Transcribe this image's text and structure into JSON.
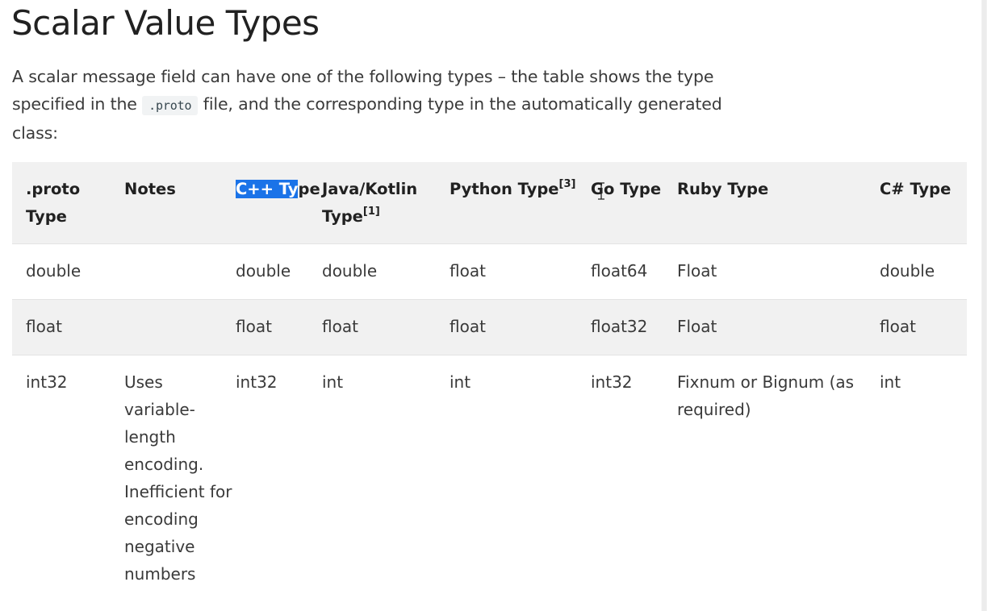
{
  "page": {
    "heading": "Scalar Value Types",
    "intro_before_code": "A scalar message field can have one of the following types – the table shows the type specified in the ",
    "intro_code": ".proto",
    "intro_after_code": " file, and the corresponding type in the automatically generated class:"
  },
  "table": {
    "headers": {
      "proto": ".proto Type",
      "notes": "Notes",
      "cpp_selected": "C++ Ty",
      "cpp_rest": "pe",
      "java": "Java/Kotlin Type",
      "java_sup": "[1]",
      "python": "Python Type",
      "python_sup": "[3]",
      "go": "Go Type",
      "ruby": "Ruby Type",
      "csharp": "C# Type"
    },
    "rows": [
      {
        "proto": "double",
        "notes": "",
        "cpp": "double",
        "java": "double",
        "python": "float",
        "go": "float64",
        "ruby": "Float",
        "csharp": "double"
      },
      {
        "proto": "float",
        "notes": "",
        "cpp": "float",
        "java": "float",
        "python": "float",
        "go": "float32",
        "ruby": "Float",
        "csharp": "float"
      },
      {
        "proto": "int32",
        "notes": "Uses variable-length encoding. Inefficient for encoding negative numbers",
        "cpp": "int32",
        "java": "int",
        "python": "int",
        "go": "int32",
        "ruby": "Fixnum or Bignum (as required)",
        "csharp": "int"
      }
    ]
  },
  "cursor": {
    "icon": "text-cursor-icon"
  },
  "colors": {
    "selection": "#1a73e8",
    "header_bg": "#f1f1f1",
    "stripe_bg": "#f1f1f1"
  }
}
